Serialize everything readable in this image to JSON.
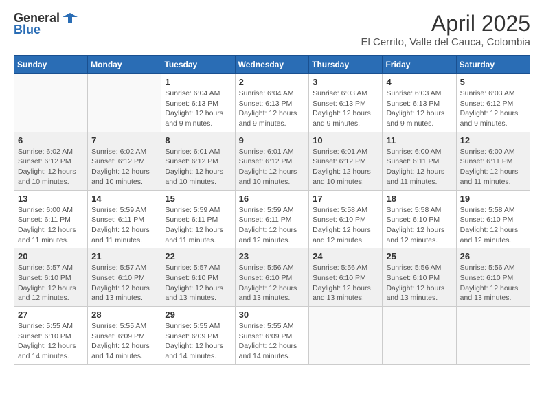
{
  "header": {
    "logo_general": "General",
    "logo_blue": "Blue",
    "month_title": "April 2025",
    "location": "El Cerrito, Valle del Cauca, Colombia"
  },
  "weekdays": [
    "Sunday",
    "Monday",
    "Tuesday",
    "Wednesday",
    "Thursday",
    "Friday",
    "Saturday"
  ],
  "weeks": [
    [
      {
        "day": "",
        "info": ""
      },
      {
        "day": "",
        "info": ""
      },
      {
        "day": "1",
        "info": "Sunrise: 6:04 AM\nSunset: 6:13 PM\nDaylight: 12 hours and 9 minutes."
      },
      {
        "day": "2",
        "info": "Sunrise: 6:04 AM\nSunset: 6:13 PM\nDaylight: 12 hours and 9 minutes."
      },
      {
        "day": "3",
        "info": "Sunrise: 6:03 AM\nSunset: 6:13 PM\nDaylight: 12 hours and 9 minutes."
      },
      {
        "day": "4",
        "info": "Sunrise: 6:03 AM\nSunset: 6:13 PM\nDaylight: 12 hours and 9 minutes."
      },
      {
        "day": "5",
        "info": "Sunrise: 6:03 AM\nSunset: 6:12 PM\nDaylight: 12 hours and 9 minutes."
      }
    ],
    [
      {
        "day": "6",
        "info": "Sunrise: 6:02 AM\nSunset: 6:12 PM\nDaylight: 12 hours and 10 minutes."
      },
      {
        "day": "7",
        "info": "Sunrise: 6:02 AM\nSunset: 6:12 PM\nDaylight: 12 hours and 10 minutes."
      },
      {
        "day": "8",
        "info": "Sunrise: 6:01 AM\nSunset: 6:12 PM\nDaylight: 12 hours and 10 minutes."
      },
      {
        "day": "9",
        "info": "Sunrise: 6:01 AM\nSunset: 6:12 PM\nDaylight: 12 hours and 10 minutes."
      },
      {
        "day": "10",
        "info": "Sunrise: 6:01 AM\nSunset: 6:12 PM\nDaylight: 12 hours and 10 minutes."
      },
      {
        "day": "11",
        "info": "Sunrise: 6:00 AM\nSunset: 6:11 PM\nDaylight: 12 hours and 11 minutes."
      },
      {
        "day": "12",
        "info": "Sunrise: 6:00 AM\nSunset: 6:11 PM\nDaylight: 12 hours and 11 minutes."
      }
    ],
    [
      {
        "day": "13",
        "info": "Sunrise: 6:00 AM\nSunset: 6:11 PM\nDaylight: 12 hours and 11 minutes."
      },
      {
        "day": "14",
        "info": "Sunrise: 5:59 AM\nSunset: 6:11 PM\nDaylight: 12 hours and 11 minutes."
      },
      {
        "day": "15",
        "info": "Sunrise: 5:59 AM\nSunset: 6:11 PM\nDaylight: 12 hours and 11 minutes."
      },
      {
        "day": "16",
        "info": "Sunrise: 5:59 AM\nSunset: 6:11 PM\nDaylight: 12 hours and 12 minutes."
      },
      {
        "day": "17",
        "info": "Sunrise: 5:58 AM\nSunset: 6:10 PM\nDaylight: 12 hours and 12 minutes."
      },
      {
        "day": "18",
        "info": "Sunrise: 5:58 AM\nSunset: 6:10 PM\nDaylight: 12 hours and 12 minutes."
      },
      {
        "day": "19",
        "info": "Sunrise: 5:58 AM\nSunset: 6:10 PM\nDaylight: 12 hours and 12 minutes."
      }
    ],
    [
      {
        "day": "20",
        "info": "Sunrise: 5:57 AM\nSunset: 6:10 PM\nDaylight: 12 hours and 12 minutes."
      },
      {
        "day": "21",
        "info": "Sunrise: 5:57 AM\nSunset: 6:10 PM\nDaylight: 12 hours and 13 minutes."
      },
      {
        "day": "22",
        "info": "Sunrise: 5:57 AM\nSunset: 6:10 PM\nDaylight: 12 hours and 13 minutes."
      },
      {
        "day": "23",
        "info": "Sunrise: 5:56 AM\nSunset: 6:10 PM\nDaylight: 12 hours and 13 minutes."
      },
      {
        "day": "24",
        "info": "Sunrise: 5:56 AM\nSunset: 6:10 PM\nDaylight: 12 hours and 13 minutes."
      },
      {
        "day": "25",
        "info": "Sunrise: 5:56 AM\nSunset: 6:10 PM\nDaylight: 12 hours and 13 minutes."
      },
      {
        "day": "26",
        "info": "Sunrise: 5:56 AM\nSunset: 6:10 PM\nDaylight: 12 hours and 13 minutes."
      }
    ],
    [
      {
        "day": "27",
        "info": "Sunrise: 5:55 AM\nSunset: 6:10 PM\nDaylight: 12 hours and 14 minutes."
      },
      {
        "day": "28",
        "info": "Sunrise: 5:55 AM\nSunset: 6:09 PM\nDaylight: 12 hours and 14 minutes."
      },
      {
        "day": "29",
        "info": "Sunrise: 5:55 AM\nSunset: 6:09 PM\nDaylight: 12 hours and 14 minutes."
      },
      {
        "day": "30",
        "info": "Sunrise: 5:55 AM\nSunset: 6:09 PM\nDaylight: 12 hours and 14 minutes."
      },
      {
        "day": "",
        "info": ""
      },
      {
        "day": "",
        "info": ""
      },
      {
        "day": "",
        "info": ""
      }
    ]
  ]
}
